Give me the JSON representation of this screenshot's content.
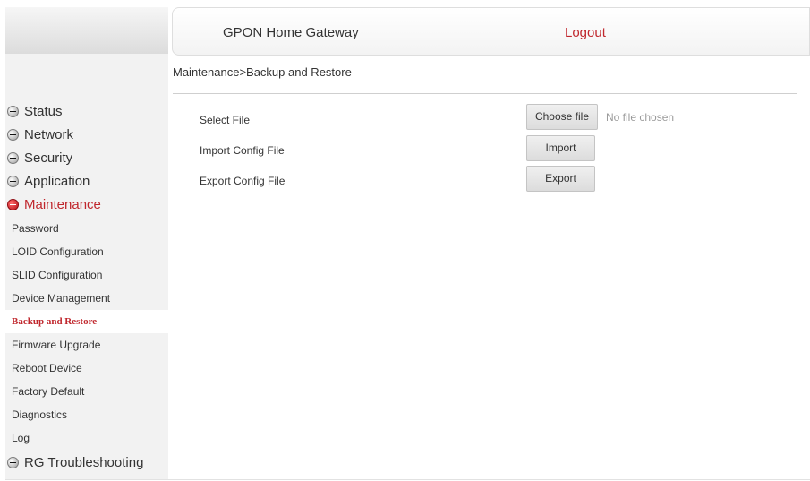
{
  "header": {
    "title": "GPON Home Gateway",
    "logout_label": "Logout"
  },
  "sidebar": {
    "items": [
      {
        "label": "Status"
      },
      {
        "label": "Network"
      },
      {
        "label": "Security"
      },
      {
        "label": "Application"
      },
      {
        "label": "Maintenance",
        "expanded": true
      }
    ],
    "maintenance_subitems": [
      {
        "label": "Password"
      },
      {
        "label": "LOID Configuration"
      },
      {
        "label": "SLID Configuration"
      },
      {
        "label": "Device Management"
      },
      {
        "label": "Backup and Restore",
        "active": true
      },
      {
        "label": "Firmware Upgrade"
      },
      {
        "label": "Reboot Device"
      },
      {
        "label": "Factory Default"
      },
      {
        "label": "Diagnostics"
      },
      {
        "label": "Log"
      }
    ],
    "last_item": {
      "label": "RG Troubleshooting"
    },
    "icons": {
      "collapsed": "plus-circle-icon",
      "expanded": "minus-circle-icon"
    }
  },
  "main": {
    "breadcrumb": "Maintenance>Backup and Restore",
    "rows": [
      {
        "label": "Select File"
      },
      {
        "label": "Import Config File"
      },
      {
        "label": "Export Config File"
      }
    ],
    "choose_file_label": "Choose file",
    "file_status": "No file chosen",
    "import_label": "Import",
    "export_label": "Export"
  },
  "colors": {
    "accent": "#c0272d",
    "sidebar_bg": "#f2f2f2",
    "text": "#333333"
  }
}
